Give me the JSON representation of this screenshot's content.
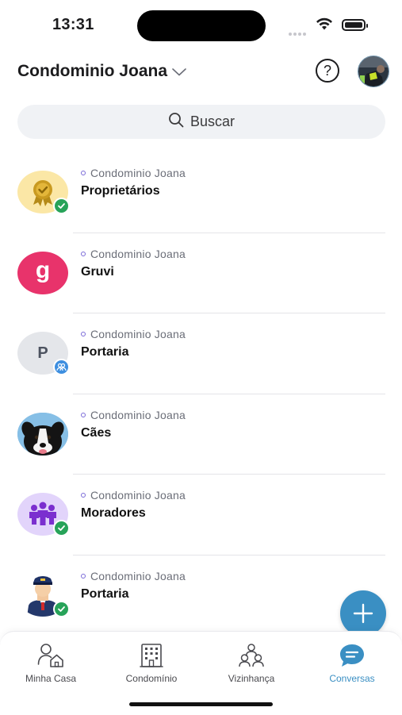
{
  "status_bar": {
    "time": "13:31"
  },
  "header": {
    "condo_name": "Condominio Joana",
    "help_symbol": "?"
  },
  "search": {
    "label": "Buscar"
  },
  "conversations": [
    {
      "condo": "Condominio Joana",
      "name": "Proprietários",
      "avatar": "award-icon",
      "badge": "verified"
    },
    {
      "condo": "Condominio Joana",
      "name": "Gruvi",
      "avatar": "gruvi-logo",
      "avatar_letter": "g",
      "badge": ""
    },
    {
      "condo": "Condominio Joana",
      "name": "Portaria",
      "avatar": "letter",
      "avatar_letter": "P",
      "badge": "group"
    },
    {
      "condo": "Condominio Joana",
      "name": "Cães",
      "avatar": "dog-photo",
      "badge": ""
    },
    {
      "condo": "Condominio Joana",
      "name": "Moradores",
      "avatar": "people-icon",
      "badge": "verified"
    },
    {
      "condo": "Condominio Joana",
      "name": "Portaria",
      "avatar": "doorman-icon",
      "badge": "verified"
    }
  ],
  "bottom_nav": {
    "tabs": [
      {
        "label": "Minha Casa",
        "icon": "person-house-icon",
        "active": false
      },
      {
        "label": "Condomínio",
        "icon": "building-icon",
        "active": false
      },
      {
        "label": "Vizinhança",
        "icon": "neighbors-icon",
        "active": false
      },
      {
        "label": "Conversas",
        "icon": "chat-bubble-icon",
        "active": true
      }
    ]
  },
  "colors": {
    "accent": "#3a8fc3",
    "verified": "#27a359",
    "group_badge": "#3e8fe0",
    "gruvi": "#e8336b"
  }
}
